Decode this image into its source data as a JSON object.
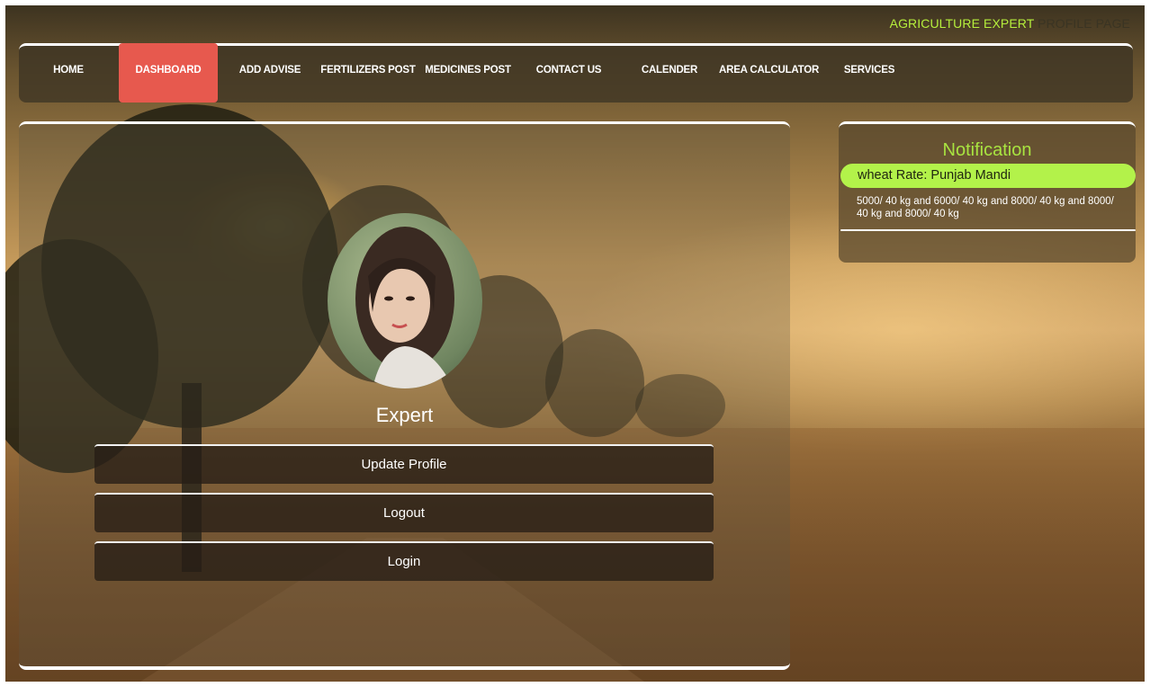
{
  "header": {
    "title_highlight": "AGRICULTURE EXPERT",
    "title_rest": "PROFILE PAGE"
  },
  "nav": {
    "items": [
      {
        "label": "HOME"
      },
      {
        "label": "DASHBOARD",
        "active": true
      },
      {
        "label": "ADD ADVISE"
      },
      {
        "label": "FERTILIZERS POST"
      },
      {
        "label": "MEDICINES POST"
      },
      {
        "label": "CONTACT US"
      },
      {
        "label": "CALENDER"
      },
      {
        "label": "AREA CALCULATOR"
      },
      {
        "label": "SERVICES"
      }
    ]
  },
  "profile": {
    "name": "Expert",
    "avatar": "profile-photo"
  },
  "menu": {
    "update_profile": "Update Profile",
    "logout": "Logout",
    "login": "Login"
  },
  "notification": {
    "title": "Notification",
    "item_title": "wheat Rate: Punjab Mandi",
    "item_body": "5000/ 40 kg and 6000/ 40 kg and 8000/ 40 kg and 8000/ 40 kg and 8000/ 40 kg"
  },
  "colors": {
    "accent_green": "#b3f24a",
    "active_nav": "#e7594e"
  }
}
